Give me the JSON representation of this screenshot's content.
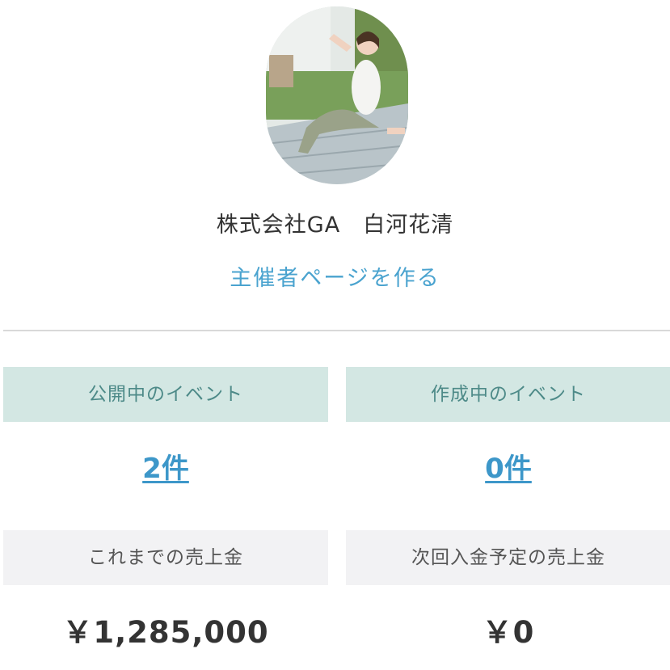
{
  "profile": {
    "organizer_name": "株式会社GA　白河花清",
    "create_page_link": "主催者ページを作る"
  },
  "stats": {
    "published": {
      "label": "公開中のイベント",
      "count": "2件"
    },
    "drafts": {
      "label": "作成中のイベント",
      "count": "0件"
    },
    "total_sales": {
      "label": "これまでの売上金",
      "amount": "￥1,285,000"
    },
    "next_payout": {
      "label": "次回入金予定の売上金",
      "amount": "￥0"
    }
  },
  "colors": {
    "accent_link": "#3d97c9",
    "header_teal": "#d3e7e3",
    "header_gray": "#f2f2f4"
  }
}
